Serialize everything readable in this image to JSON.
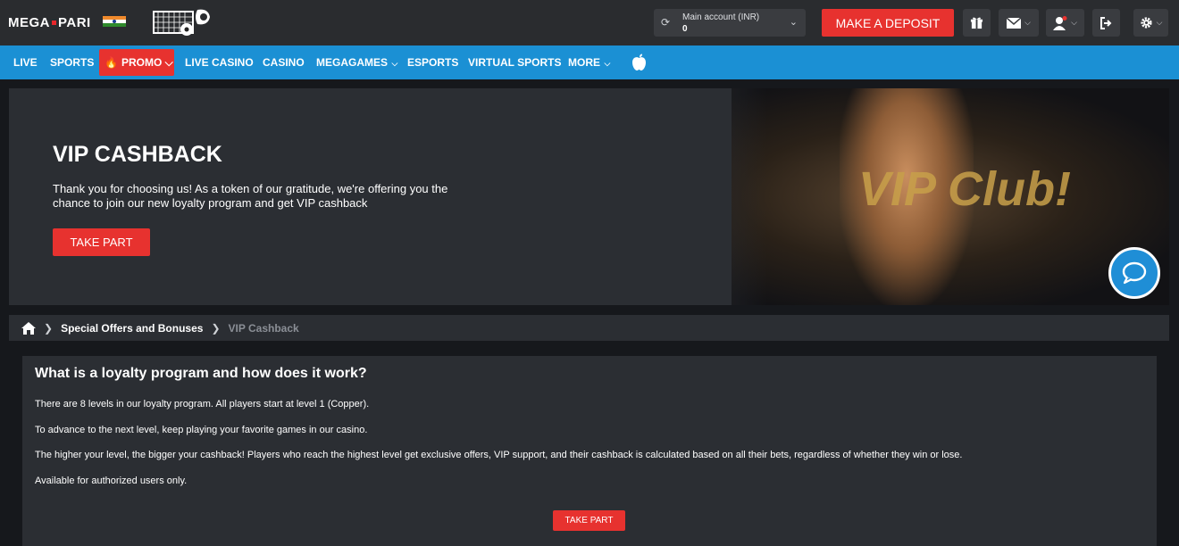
{
  "header": {
    "logo": {
      "left": "MEGA",
      "right": "PARI"
    },
    "account": {
      "label": "Main account (INR)",
      "value": "0"
    },
    "deposit_label": "MAKE A DEPOSIT"
  },
  "nav": {
    "items": [
      {
        "label": "LIVE"
      },
      {
        "label": "SPORTS"
      },
      {
        "label": "PROMO"
      },
      {
        "label": "LIVE CASINO"
      },
      {
        "label": "CASINO"
      },
      {
        "label": "MEGAGAMES"
      },
      {
        "label": "ESPORTS"
      },
      {
        "label": "VIRTUAL SPORTS"
      },
      {
        "label": "MORE"
      }
    ]
  },
  "hero": {
    "title": "VIP CASHBACK",
    "text": "Thank you for choosing us! As a token of our gratitude, we're offering you the chance to join our new loyalty program and get VIP cashback",
    "button": "TAKE PART",
    "banner_text": "VIP Club!"
  },
  "breadcrumb": {
    "items": [
      "Special Offers and Bonuses",
      "VIP Cashback"
    ]
  },
  "content": {
    "heading": "What is a loyalty program and how does it work?",
    "paragraphs": [
      "There are 8 levels in our loyalty program. All players start at level 1 (Copper).",
      "To advance to the next level, keep playing your favorite games in our casino.",
      "The higher your level, the bigger your cashback! Players who reach the highest level get exclusive offers, VIP support, and their cashback is calculated based on all their bets, regardless of whether they win or lose.",
      "Available for authorized users only."
    ],
    "button": "TAKE PART"
  },
  "colors": {
    "accent_red": "#e7322f",
    "nav_blue": "#1b90d4",
    "topbar": "#2a2c2f",
    "panel": "#2b2e33"
  }
}
